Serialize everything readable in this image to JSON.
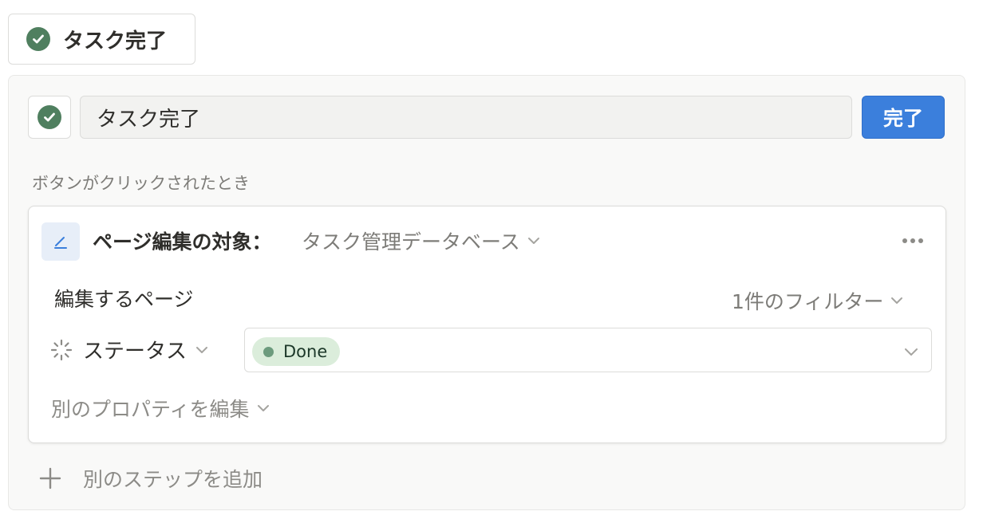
{
  "button_preview": {
    "label": "タスク完了",
    "icon": "check-circle-icon"
  },
  "editor": {
    "name_value": "タスク完了",
    "done_label": "完了",
    "trigger_label": "ボタンがクリックされたとき"
  },
  "step": {
    "title": "ページ編集の対象：",
    "database": "タスク管理データベース",
    "edit_pages_label": "編集するページ",
    "filter_label": "1件のフィルター",
    "property_name": "ステータス",
    "property_value": "Done",
    "edit_other_label": "別のプロパティを編集"
  },
  "add_step_label": "別のステップを追加",
  "colors": {
    "accent_blue": "#3b7fdc",
    "check_green": "#4f7f5f",
    "done_tag_bg": "#dbeddb",
    "done_dot": "#6c9b7d"
  }
}
